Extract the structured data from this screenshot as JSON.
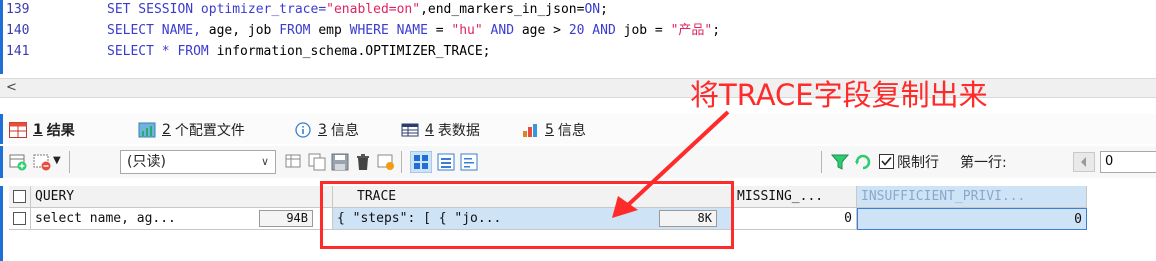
{
  "editor": {
    "lines": [
      {
        "num": "139",
        "segments": [
          {
            "t": "SET SESSION optimizer_trace=",
            "c": "kw"
          },
          {
            "t": "\"enabled=on\"",
            "c": "str"
          },
          {
            "t": ",end_markers_in_json=",
            "c": "plain"
          },
          {
            "t": "ON",
            "c": "kw"
          },
          {
            "t": ";",
            "c": "plain"
          }
        ]
      },
      {
        "num": "140",
        "segments": [
          {
            "t": "SELECT NAME, ",
            "c": "kw"
          },
          {
            "t": "age, job ",
            "c": "plain"
          },
          {
            "t": "FROM ",
            "c": "kw"
          },
          {
            "t": "emp ",
            "c": "plain"
          },
          {
            "t": "WHERE NAME ",
            "c": "kw"
          },
          {
            "t": "= ",
            "c": "plain"
          },
          {
            "t": "\"hu\"",
            "c": "str"
          },
          {
            "t": " AND ",
            "c": "kw"
          },
          {
            "t": "age > ",
            "c": "plain"
          },
          {
            "t": "20",
            "c": "num"
          },
          {
            "t": " AND ",
            "c": "kw"
          },
          {
            "t": "job = ",
            "c": "plain"
          },
          {
            "t": "\"产品\"",
            "c": "str"
          },
          {
            "t": ";",
            "c": "plain"
          }
        ]
      },
      {
        "num": "141",
        "segments": [
          {
            "t": "SELECT * FROM ",
            "c": "kw"
          },
          {
            "t": "information_schema.OPTIMIZER_TRACE;",
            "c": "plain"
          }
        ]
      }
    ]
  },
  "scroll_left_arrow": "<",
  "annotation": "将TRACE字段复制出来",
  "tabs": [
    {
      "num": "1",
      "label": "结果",
      "icon": "result-grid-icon",
      "active": true
    },
    {
      "num": "2",
      "label": "个配置文件",
      "icon": "profile-icon",
      "active": false
    },
    {
      "num": "3",
      "label": "信息",
      "icon": "info-icon",
      "active": false
    },
    {
      "num": "4",
      "label": "表数据",
      "icon": "table-data-icon",
      "active": false
    },
    {
      "num": "5",
      "label": "信息",
      "icon": "info-chart-icon",
      "active": false
    }
  ],
  "toolbar": {
    "readonly_label": "(只读)",
    "limit_rows_label": "限制行",
    "first_row_label": "第一行:",
    "first_row_value": "0"
  },
  "grid": {
    "headers": [
      "QUERY",
      "TRACE",
      "MISSING_...",
      "INSUFFICIENT_PRIVI..."
    ],
    "row": {
      "query": "select name, ag...",
      "query_size": "94B",
      "trace": "{  \"steps\": [    {      \"jo...",
      "trace_size": "8K",
      "missing": "0",
      "insufficient": "0"
    }
  },
  "colors": {
    "accent": "#1f6fd6",
    "annotation": "#ff2a2a",
    "keyword": "#3b3bd0",
    "string": "#e0245e",
    "selected": "#cfe3f7"
  }
}
